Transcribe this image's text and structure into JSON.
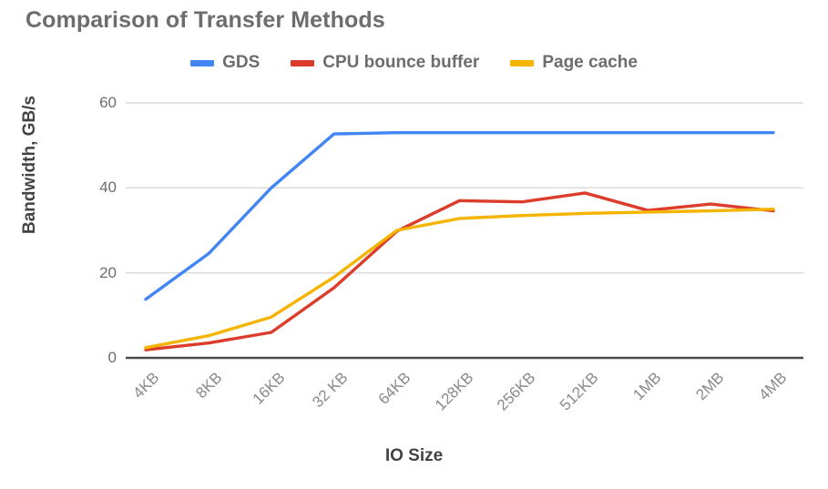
{
  "chart_data": {
    "type": "line",
    "title": "Comparison of Transfer Methods",
    "xlabel": "IO Size",
    "ylabel": "Bandwidth, GB/s",
    "categories": [
      "4KB",
      "8KB",
      "16KB",
      "32 KB",
      "64KB",
      "128KB",
      "256KB",
      "512KB",
      "1MB",
      "2MB",
      "4MB"
    ],
    "series": [
      {
        "name": "GDS",
        "color": "#4285f4",
        "values": [
          13.8,
          24.5,
          40.0,
          52.7,
          53.0,
          53.0,
          53.0,
          53.0,
          53.0,
          53.0,
          53.0
        ]
      },
      {
        "name": "CPU bounce buffer",
        "color": "#dc3d2a",
        "values": [
          1.9,
          3.5,
          6.0,
          16.5,
          29.8,
          37.0,
          36.7,
          38.8,
          34.7,
          36.2,
          34.6
        ]
      },
      {
        "name": "Page cache",
        "color": "#f5b400",
        "values": [
          2.4,
          5.2,
          9.6,
          19.0,
          30.0,
          32.8,
          33.5,
          34.0,
          34.3,
          34.6,
          35.0
        ]
      }
    ],
    "ylim": [
      0,
      60
    ],
    "y_ticks": [
      0,
      20,
      40,
      60
    ],
    "grid": true,
    "legend_position": "top"
  },
  "legend": {
    "items": [
      {
        "label": "GDS",
        "color": "#4285f4"
      },
      {
        "label": "CPU bounce buffer",
        "color": "#dc3d2a"
      },
      {
        "label": "Page cache",
        "color": "#f5b400"
      }
    ]
  },
  "axis_colors": {
    "gridline": "#d9d9d9",
    "baseline": "#4a4a4a",
    "tick_text": "#6d6d6d",
    "title_text": "#6d6d6d"
  }
}
